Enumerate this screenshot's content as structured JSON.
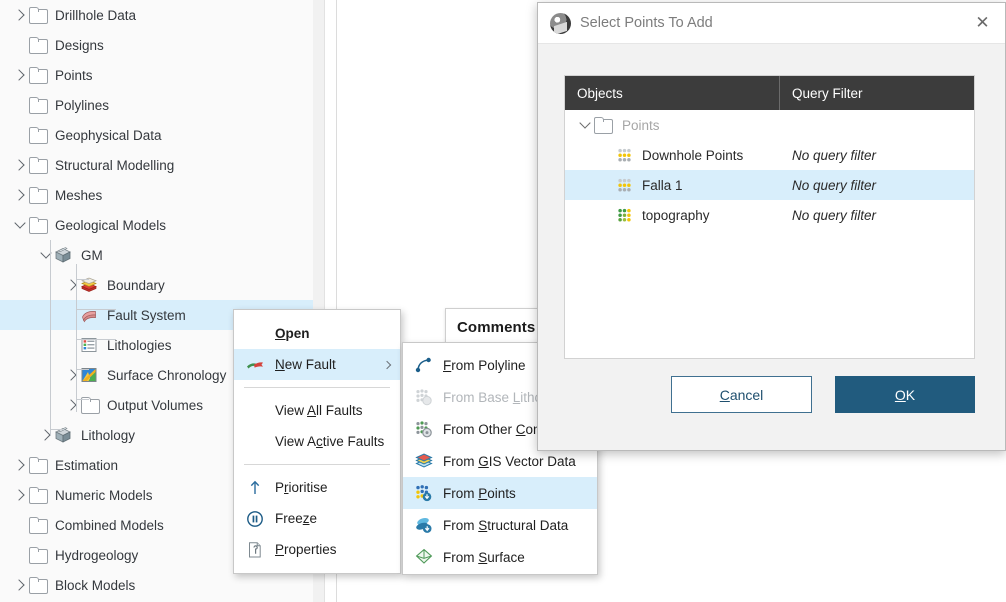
{
  "tree": {
    "name": "project-tree",
    "items": [
      {
        "label": "Drillhole Data",
        "indent": 0,
        "twisty": "right",
        "icon": "folder-icon",
        "selected": false
      },
      {
        "label": "Designs",
        "indent": 0,
        "twisty": "none",
        "icon": "folder-icon",
        "selected": false
      },
      {
        "label": "Points",
        "indent": 0,
        "twisty": "right",
        "icon": "folder-icon",
        "selected": false
      },
      {
        "label": "Polylines",
        "indent": 0,
        "twisty": "none",
        "icon": "folder-icon",
        "selected": false
      },
      {
        "label": "Geophysical Data",
        "indent": 0,
        "twisty": "none",
        "icon": "folder-icon",
        "selected": false
      },
      {
        "label": "Structural Modelling",
        "indent": 0,
        "twisty": "right",
        "icon": "folder-icon",
        "selected": false
      },
      {
        "label": "Meshes",
        "indent": 0,
        "twisty": "right",
        "icon": "folder-icon",
        "selected": false
      },
      {
        "label": "Geological Models",
        "indent": 0,
        "twisty": "down",
        "icon": "folder-icon",
        "selected": false
      },
      {
        "label": "GM",
        "indent": 1,
        "twisty": "down",
        "icon": "geological-model-icon",
        "selected": false
      },
      {
        "label": "Boundary",
        "indent": 2,
        "twisty": "right",
        "icon": "boundary-icon",
        "selected": false
      },
      {
        "label": "Fault System",
        "indent": 2,
        "twisty": "none",
        "icon": "fault-icon",
        "selected": true
      },
      {
        "label": "Lithologies",
        "indent": 2,
        "twisty": "none",
        "icon": "lithologies-icon",
        "selected": false
      },
      {
        "label": "Surface Chronology",
        "indent": 2,
        "twisty": "right",
        "icon": "chronology-icon",
        "selected": false
      },
      {
        "label": "Output Volumes",
        "indent": 2,
        "twisty": "right",
        "icon": "folder-icon",
        "selected": false
      },
      {
        "label": "Lithology",
        "indent": 1,
        "twisty": "right",
        "icon": "geological-model-icon",
        "selected": false
      },
      {
        "label": "Estimation",
        "indent": 0,
        "twisty": "right",
        "icon": "folder-icon",
        "selected": false
      },
      {
        "label": "Numeric Models",
        "indent": 0,
        "twisty": "right",
        "icon": "folder-icon",
        "selected": false
      },
      {
        "label": "Combined Models",
        "indent": 0,
        "twisty": "none",
        "icon": "folder-icon",
        "selected": false
      },
      {
        "label": "Hydrogeology",
        "indent": 0,
        "twisty": "none",
        "icon": "folder-icon",
        "selected": false
      },
      {
        "label": "Block Models",
        "indent": 0,
        "twisty": "right",
        "icon": "folder-icon",
        "selected": false
      }
    ]
  },
  "comments_panel": {
    "title": "Comments"
  },
  "context_menu": {
    "items": [
      {
        "label": "Open",
        "accel": "O",
        "icon": "none",
        "bold": true,
        "highlighted": false,
        "disabled": false,
        "submenu": false
      },
      {
        "label": "New Fault",
        "accel": "N",
        "icon": "new-fault-icon",
        "bold": false,
        "highlighted": true,
        "disabled": false,
        "submenu": true
      },
      {
        "separator": true
      },
      {
        "label": "View All Faults",
        "accel": "A",
        "icon": "none",
        "bold": false,
        "highlighted": false,
        "disabled": false,
        "submenu": false
      },
      {
        "label": "View Active Faults",
        "accel": "c",
        "icon": "none",
        "bold": false,
        "highlighted": false,
        "disabled": false,
        "submenu": false
      },
      {
        "separator": true
      },
      {
        "label": "Prioritise",
        "accel": "r",
        "icon": "up-arrow-icon",
        "bold": false,
        "highlighted": false,
        "disabled": false,
        "submenu": false
      },
      {
        "label": "Freeze",
        "accel": "z",
        "icon": "pause-icon",
        "bold": false,
        "highlighted": false,
        "disabled": false,
        "submenu": false
      },
      {
        "label": "Properties",
        "accel": "P",
        "icon": "properties-icon",
        "bold": false,
        "highlighted": false,
        "disabled": false,
        "submenu": false
      }
    ]
  },
  "submenu": {
    "items": [
      {
        "label": "From Polyline",
        "accel": "F",
        "icon": "polyline-icon",
        "highlighted": false,
        "disabled": false
      },
      {
        "label": "From Base Lithology",
        "accel": "L",
        "icon": "base-lithology-icon",
        "highlighted": false,
        "disabled": true
      },
      {
        "label": "From Other Contacts",
        "accel": "C",
        "icon": "other-contacts-icon",
        "highlighted": false,
        "disabled": false
      },
      {
        "label": "From GIS Vector Data",
        "accel": "G",
        "icon": "gis-vector-icon",
        "highlighted": false,
        "disabled": false
      },
      {
        "label": "From Points",
        "accel": "P",
        "icon": "from-points-icon",
        "highlighted": true,
        "disabled": false
      },
      {
        "label": "From Structural Data",
        "accel": "S",
        "icon": "structural-data-icon",
        "highlighted": false,
        "disabled": false
      },
      {
        "label": "From Surface",
        "accel": "S",
        "icon": "surface-icon",
        "highlighted": false,
        "disabled": false
      }
    ]
  },
  "dialog": {
    "title": "Select Points To Add",
    "close_label": "✕",
    "table": {
      "columns": [
        "Objects",
        "Query Filter"
      ],
      "rows": [
        {
          "label": "Points",
          "filter": "",
          "level": "root",
          "icon": "folder-icon",
          "twisty": "down",
          "selected": false,
          "dim": true
        },
        {
          "label": "Downhole Points",
          "filter": "No query filter",
          "level": "child",
          "icon": "points-yellow-icon",
          "twisty": "none",
          "selected": false,
          "dim": false
        },
        {
          "label": "Falla 1",
          "filter": "No query filter",
          "level": "child",
          "icon": "points-yellow-icon",
          "twisty": "none",
          "selected": true,
          "dim": false
        },
        {
          "label": "topography",
          "filter": "No query filter",
          "level": "child",
          "icon": "points-green-icon",
          "twisty": "none",
          "selected": false,
          "dim": false
        }
      ]
    },
    "buttons": {
      "cancel": "Cancel",
      "ok": "OK"
    }
  },
  "colors": {
    "selection_blue": "#d8eefb",
    "table_header_bg": "#3c3c3c",
    "ok_button_bg": "#215b7e",
    "cancel_border": "#3f7090",
    "dialog_bg": "#f2f2f2",
    "tree_bg": "#fafafa"
  }
}
